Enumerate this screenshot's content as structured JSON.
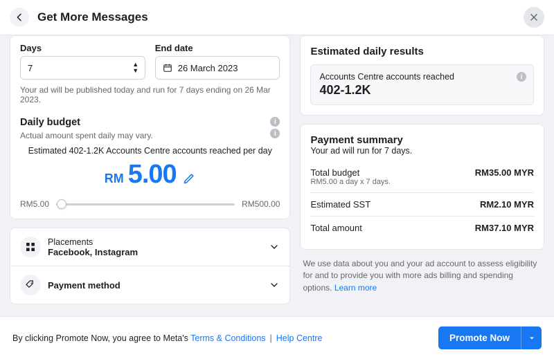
{
  "header": {
    "title": "Get More Messages"
  },
  "duration": {
    "days_label": "Days",
    "days_value": "7",
    "enddate_label": "End date",
    "enddate_value": "26 March 2023",
    "publish_note": "Your ad will be published today and run for 7 days ending on 26 Mar 2023."
  },
  "budget": {
    "title": "Daily budget",
    "subtitle": "Actual amount spent daily may vary.",
    "estimate": "Estimated 402-1.2K Accounts Centre accounts reached per day",
    "currency": "RM",
    "amount": "5.00",
    "slider_min": "RM5.00",
    "slider_max": "RM500.00"
  },
  "placements": {
    "label": "Placements",
    "value": "Facebook, Instagram"
  },
  "payment_method": {
    "label": "Payment method"
  },
  "estimated": {
    "title": "Estimated daily results",
    "reach_label": "Accounts Centre accounts reached",
    "reach_value": "402-1.2K"
  },
  "summary": {
    "title": "Payment summary",
    "subtitle": "Your ad will run for 7 days.",
    "rows": [
      {
        "label": "Total budget",
        "sub": "RM5.00 a day x 7 days.",
        "value": "RM35.00 MYR"
      },
      {
        "label": "Estimated SST",
        "value": "RM2.10 MYR"
      },
      {
        "label": "Total amount",
        "value": "RM37.10 MYR"
      }
    ]
  },
  "disclaimer": {
    "text": "We use data about you and your ad account to assess eligibility for and to provide you with more ads billing and spending options. ",
    "link": "Learn more"
  },
  "footer": {
    "prefix": "By clicking Promote Now, you agree to Meta's ",
    "terms": "Terms & Conditions",
    "help": "Help Centre",
    "cta": "Promote Now"
  }
}
